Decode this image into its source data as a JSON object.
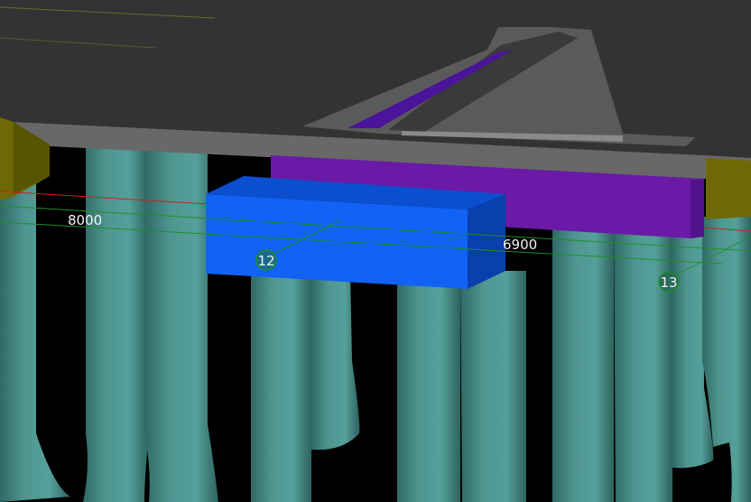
{
  "viewport": {
    "name": "3D model view",
    "background": "#000000"
  },
  "dimensions": [
    {
      "id": "dim-8000",
      "text": "8000"
    },
    {
      "id": "dim-6900",
      "text": "6900"
    }
  ],
  "grid_bubbles": [
    {
      "id": "grid-12",
      "text": "12"
    },
    {
      "id": "grid-13",
      "text": "13"
    }
  ],
  "colors": {
    "slab_top": "#333333",
    "slab_edge": "#686868",
    "pile": "#4f9590",
    "pile_dark": "#3d7a76",
    "beam_purple": "#6a1aa6",
    "cap_blue": "#1162f5",
    "cap_blue_side": "#0a3fae",
    "column_olive": "#6d6a05",
    "grid_line": "#1f8f2a",
    "section_line": "#d02020"
  }
}
